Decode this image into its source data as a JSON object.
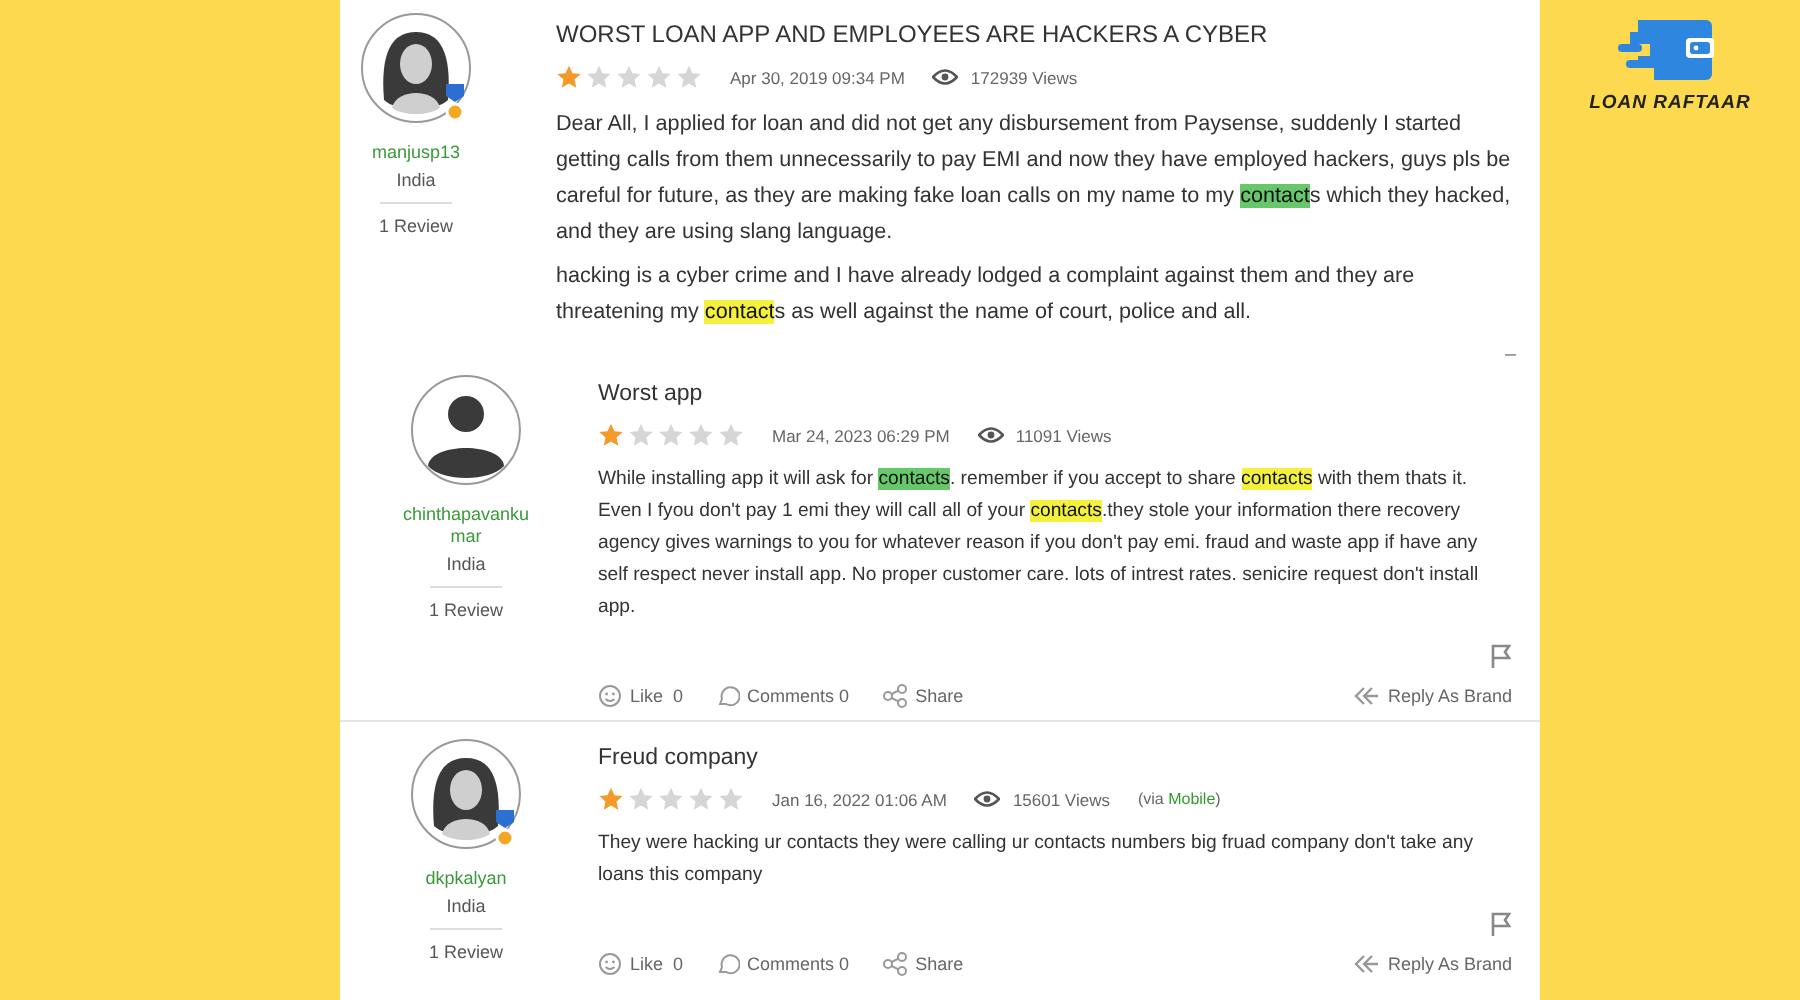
{
  "brand": {
    "name": "LOAN RAFTAAR"
  },
  "reviews": [
    {
      "user": {
        "name": "manjusp13",
        "country": "India",
        "review_count": "1 Review",
        "avatar": {
          "kind": "female"
        },
        "badge": true
      },
      "title": "WORST LOAN APP AND EMPLOYEES ARE HACKERS A CYBER",
      "stars": 1,
      "date": "Apr 30, 2019 09:34 PM",
      "views": "172939 Views",
      "paragraphs": [
        [
          {
            "text": "Dear All, I applied for loan and did not get any disbursement from Paysense, suddenly I started getting calls from them unnecessarily to pay EMI and now they have employed hackers, guys pls be careful for future, as they are making fake loan calls on my name to my "
          },
          {
            "text": "contact",
            "color": "#66c86a"
          },
          {
            "text": "s which they hacked, and they are using slang language."
          }
        ],
        [
          {
            "text": "hacking is a cyber crime and I have already lodged a complaint against them and they are threatening my "
          },
          {
            "text": "contact",
            "color": "#f5f03c"
          },
          {
            "text": "s as well against the name of court, police and all."
          }
        ]
      ],
      "collapse": "–"
    },
    {
      "user": {
        "name": "chinthapavankumar",
        "country": "India",
        "review_count": "1 Review",
        "avatar": {
          "kind": "generic"
        },
        "badge": false
      },
      "title": "Worst app",
      "stars": 1,
      "date": "Mar 24, 2023 06:29 PM",
      "views": "11091 Views",
      "paragraphs": [
        [
          {
            "text": "While installing app it will ask for "
          },
          {
            "text": "contacts",
            "color": "#66c86a"
          },
          {
            "text": ". remember if you accept to share "
          },
          {
            "text": "contacts",
            "color": "#f5f03c"
          },
          {
            "text": " with them thats it. Even I fyou don't pay 1 emi they will call all of your "
          },
          {
            "text": "contacts",
            "color": "#f5f03c"
          },
          {
            "text": ".they stole your information there recovery agency gives warnings to you for whatever reason if you don't pay emi. fraud and waste app if have any self respect never install app. No proper customer care. lots of intrest rates. senicire request don't install app."
          }
        ]
      ],
      "actions": {
        "like": "Like",
        "like_count": "0",
        "comments": "Comments 0",
        "share": "Share",
        "reply": "Reply As Brand"
      }
    },
    {
      "user": {
        "name": "dkpkalyan",
        "country": "India",
        "review_count": "1 Review",
        "avatar": {
          "kind": "female"
        },
        "badge": true
      },
      "title": "Freud company",
      "stars": 1,
      "date": "Jan 16, 2022 01:06 AM",
      "views": "15601 Views",
      "via": {
        "prefix": "(via ",
        "source": "Mobile",
        "suffix": ")"
      },
      "paragraphs": [
        [
          {
            "text": "They were hacking ur contacts they were calling ur contacts numbers big fruad company don't take any loans this company"
          }
        ]
      ],
      "actions": {
        "like": "Like",
        "like_count": "0",
        "comments": "Comments 0",
        "share": "Share",
        "reply": "Reply As Brand"
      }
    }
  ]
}
